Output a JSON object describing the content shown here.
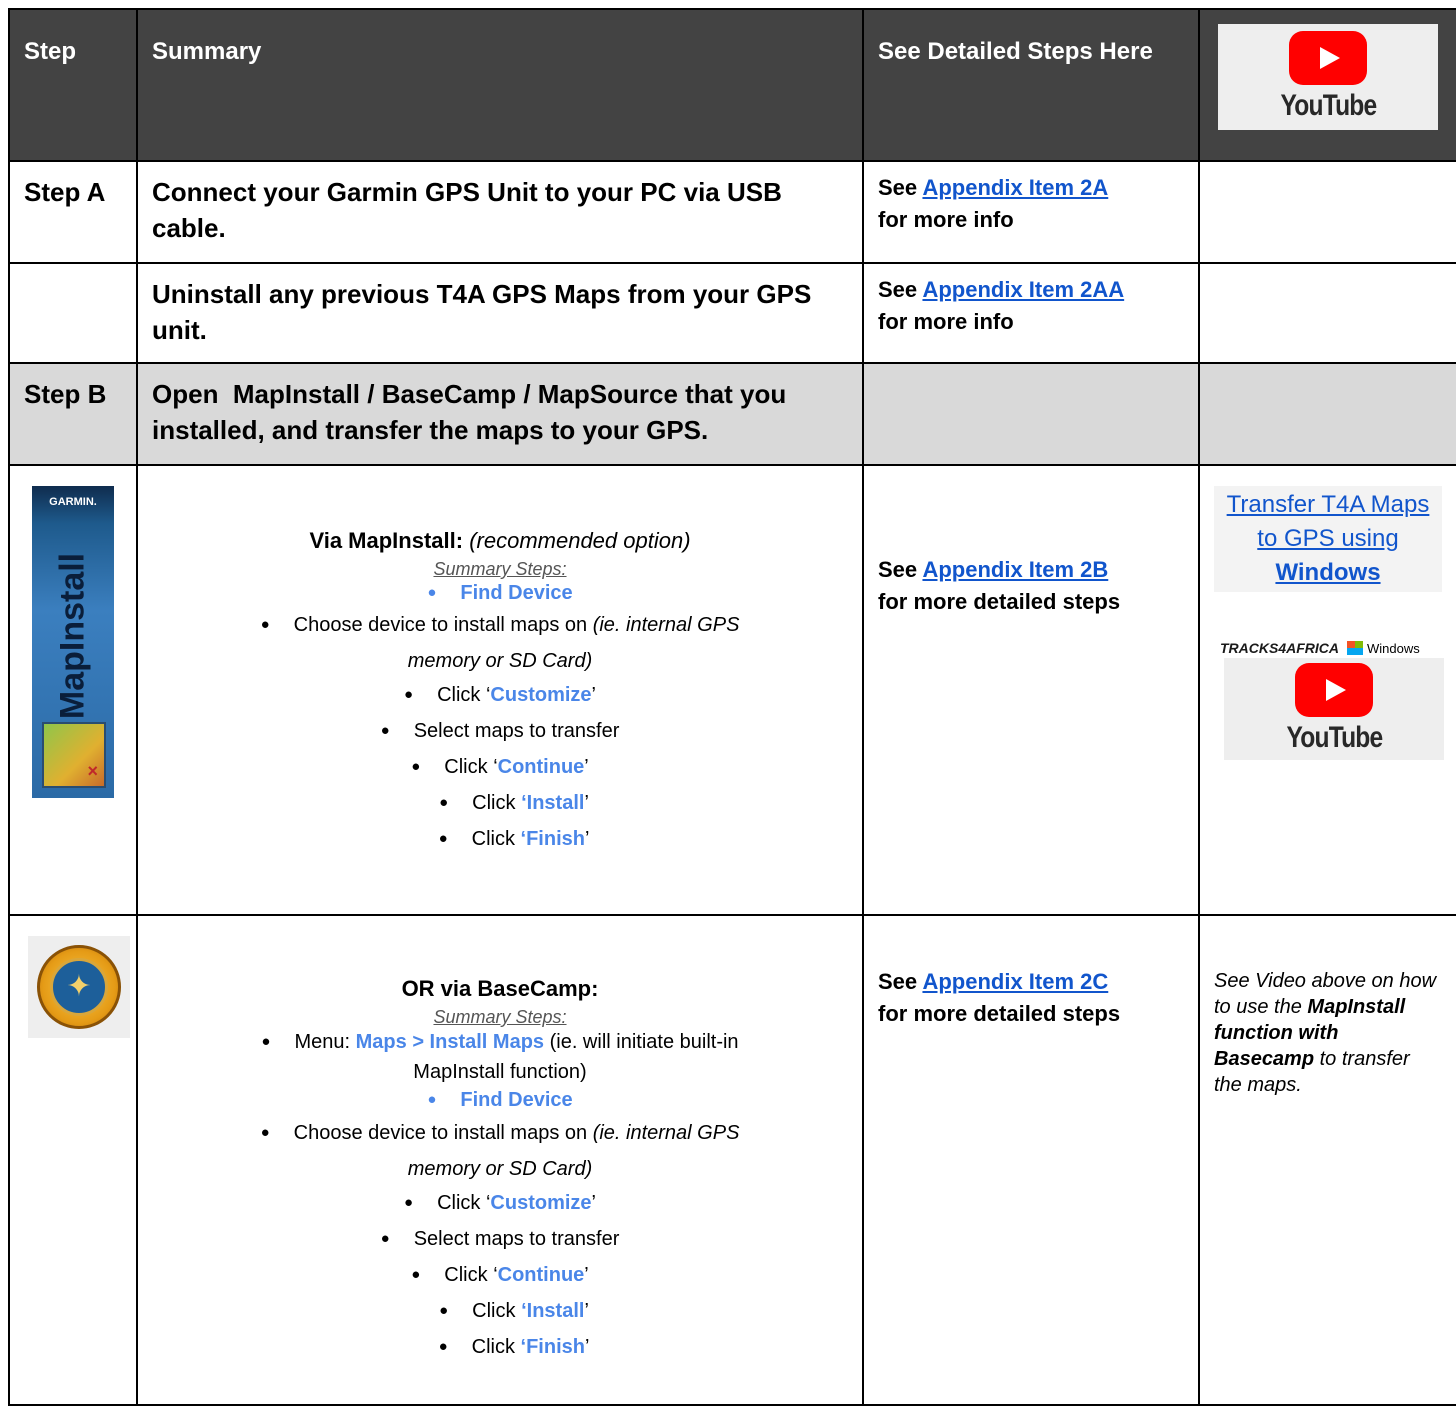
{
  "header": {
    "step": "Step",
    "summary": "Summary",
    "detailed": "See Detailed Steps Here",
    "youtube_word": "YouTube"
  },
  "rows": {
    "a": {
      "step": "Step A",
      "summary": "Connect your Garmin GPS Unit to your PC via USB cable.",
      "see": "See",
      "link": "Appendix Item 2A",
      "after": "for more info"
    },
    "aa": {
      "summary": "Uninstall any previous T4A GPS Maps from your GPS unit.",
      "see": "See",
      "link": "Appendix Item 2AA",
      "after": "for more info"
    },
    "b": {
      "step": "Step B",
      "summary": "Open  MapInstall / BaseCamp / MapSource that you installed, and transfer the maps to your GPS."
    },
    "mapinstall": {
      "icon_brand": "GARMIN.",
      "icon_word": "MapInstall",
      "title": "Via MapInstall:",
      "title_note": "(recommended option)",
      "summary_steps": "Summary Steps:",
      "find_device": "Find Device",
      "choose_device": "Choose device to install maps on",
      "choose_note_1": "(ie. internal GPS",
      "choose_note_2": "memory or SD Card)",
      "click": "Click",
      "customize": "Customize",
      "select_maps": "Select maps to transfer",
      "continue": "Continue",
      "install": "Install",
      "finish": "Finish",
      "see": "See",
      "link": "Appendix Item 2B",
      "after": "for more detailed steps",
      "video_link_1": "Transfer T4A Maps to GPS using ",
      "video_link_bold": "Windows",
      "tracks_brand": "TRACKS4AFRICA",
      "windows_word": "Windows",
      "youtube_word": "YouTube"
    },
    "basecamp": {
      "title": "OR via BaseCamp:",
      "summary_steps": "Summary Steps:",
      "menu": "Menu:",
      "menu_path": "Maps > Install Maps",
      "menu_note_1": "(ie. will initiate built-in",
      "menu_note_2": "MapInstall function)",
      "find_device": "Find Device",
      "choose_device": "Choose device to install maps on",
      "choose_note_1": "(ie. internal GPS",
      "choose_note_2": "memory or SD Card)",
      "click": "Click",
      "customize": "Customize",
      "select_maps": "Select maps to transfer",
      "continue": "Continue",
      "install": "Install",
      "finish": "Finish",
      "see": "See",
      "link": "Appendix Item 2C",
      "after": "for more detailed steps",
      "note_1": "See Video above on how to use the ",
      "note_bold": "MapInstall function with Basecamp",
      "note_2": " to transfer the maps."
    }
  },
  "colors": {
    "header_bg": "#434343",
    "gray_row": "#d9d9d9",
    "link": "#1155cc",
    "accent_blue": "#4a86e8",
    "youtube_red": "#ff0000"
  }
}
